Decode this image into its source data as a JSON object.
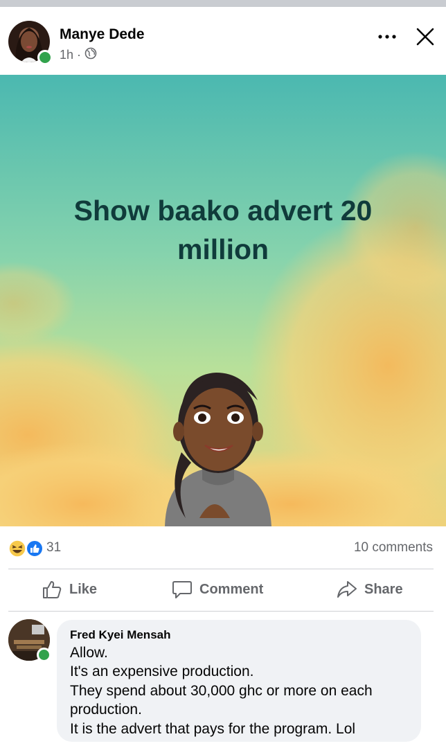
{
  "post": {
    "author": "Manye Dede",
    "time": "1h",
    "separator": "·",
    "privacy_icon": "globe-icon",
    "text_line1": "Show baako advert 20",
    "text_line2": "million",
    "background_colors": {
      "sky_top": "#4fbcae",
      "sky_mid": "#8ed8a8",
      "cloud": "#f4c770",
      "text": "#103b3b"
    }
  },
  "header_controls": {
    "more_icon": "more-horizontal-icon",
    "close_icon": "close-icon"
  },
  "stats": {
    "reaction_icons": [
      "haha-icon",
      "like-reaction-icon"
    ],
    "reaction_count": "31",
    "comments": "10 comments"
  },
  "actions": {
    "like": "Like",
    "comment": "Comment",
    "share": "Share"
  },
  "comment": {
    "author": "Fred Kyei Mensah",
    "lines": [
      "Allow.",
      "It's an expensive production.",
      "They spend about 30,000 ghc or more on each",
      "production.",
      "It is the advert that pays for the program. Lol"
    ]
  },
  "colors": {
    "secondary_text": "#65676b",
    "online": "#31a24c",
    "like_blue": "#1877f2",
    "bubble": "#f0f2f5"
  }
}
